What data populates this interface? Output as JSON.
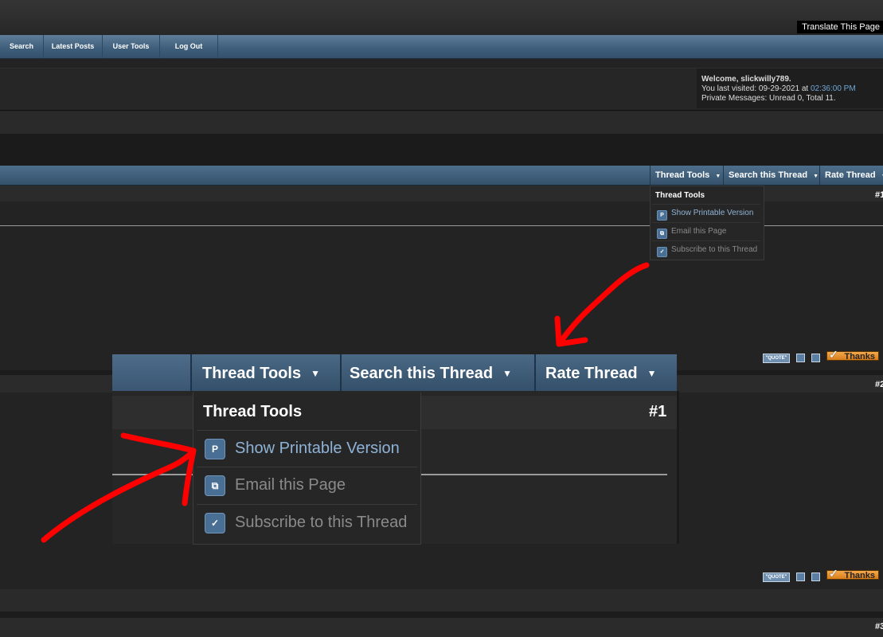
{
  "header": {
    "translate_label": "Translate This Page"
  },
  "nav": {
    "items": [
      "Search",
      "Latest Posts",
      "User Tools",
      "Log Out"
    ]
  },
  "welcome": {
    "greeting_prefix": "Welcome, ",
    "username": "slickwilly789.",
    "last_visited_prefix": "You last visited: 09-29-2021 at ",
    "last_visited_time": "02:36:00 PM",
    "private_messages": "Private Messages: Unread 0, Total 11."
  },
  "thread_toolbar": {
    "thread_tools": "Thread Tools",
    "search_thread": "Search this Thread",
    "rate_thread": "Rate Thread",
    "caret": "▼"
  },
  "posts": {
    "post1_number": "#1",
    "post2_number": "#2",
    "post3_number": "#3"
  },
  "thread_tools_menu": {
    "title": "Thread Tools",
    "items": [
      {
        "label": "Show Printable Version",
        "icon": "printer-icon",
        "glyph": "P"
      },
      {
        "label": "Email this Page",
        "icon": "email-icon",
        "glyph": "⧉"
      },
      {
        "label": "Subscribe to this Thread",
        "icon": "checkmark-icon",
        "glyph": "✓"
      }
    ]
  },
  "post_buttons": {
    "quote": "\"QUOTE\"",
    "thanks": "Thanks"
  },
  "colors": {
    "nav_blue": "#3f5f7c",
    "link_blue": "#6fa7d6",
    "thanks_orange": "#f4a94a",
    "annotation_red": "#ff0000"
  }
}
